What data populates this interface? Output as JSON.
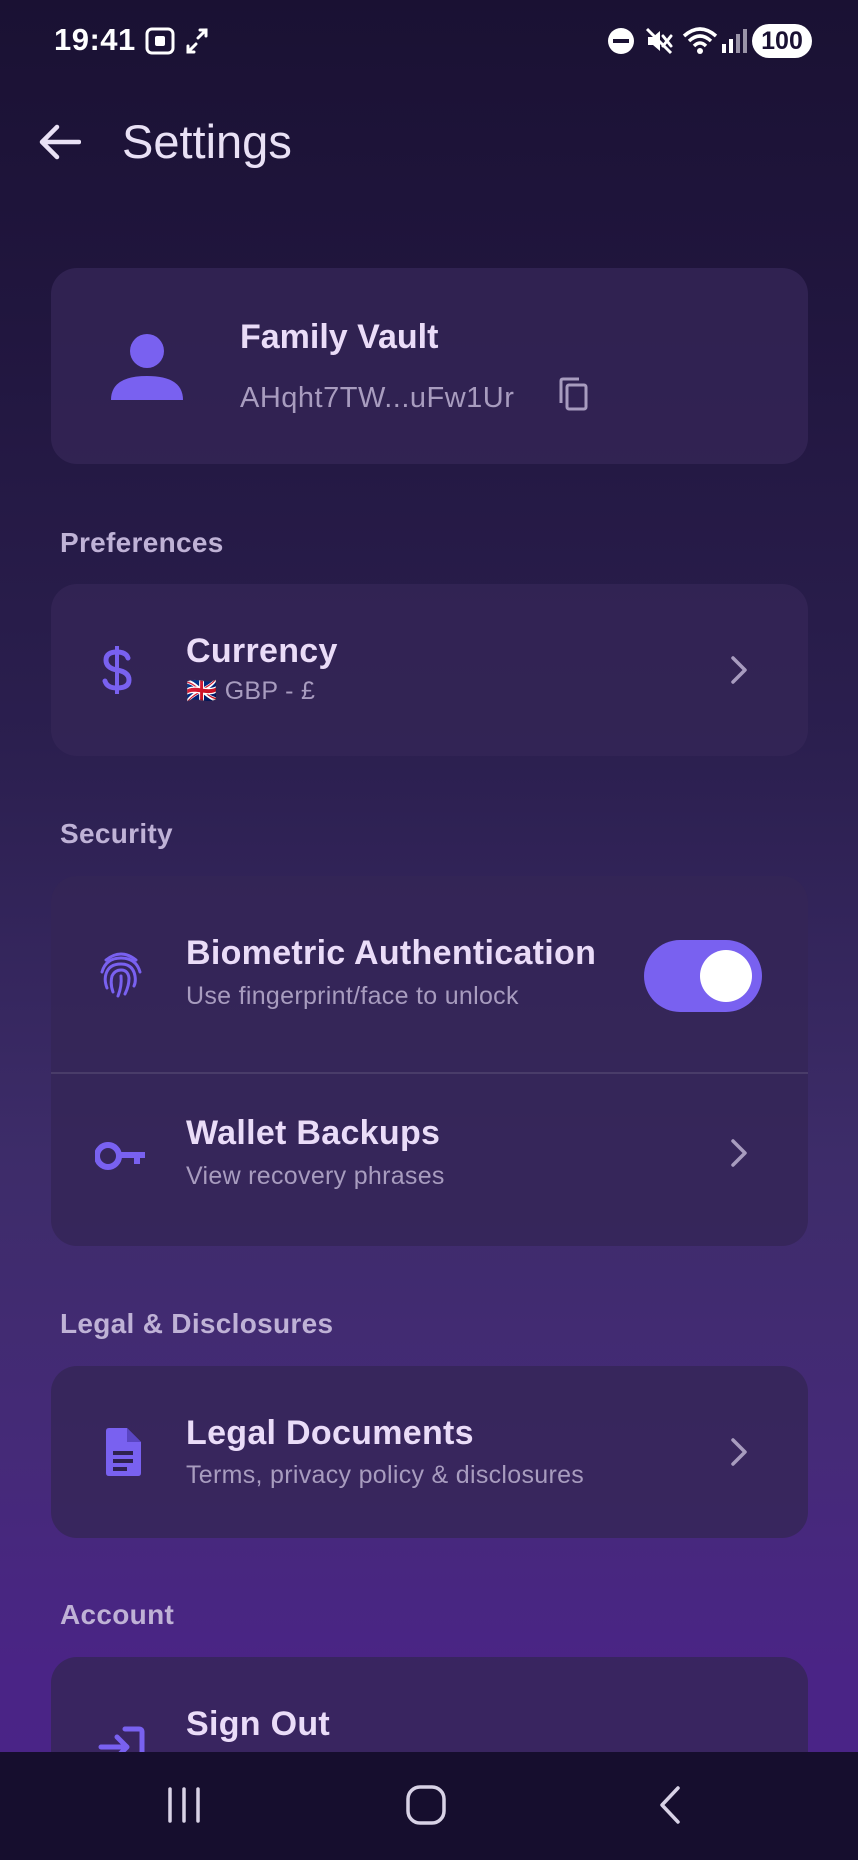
{
  "status_bar": {
    "time": "19:41",
    "battery": "100",
    "icons": [
      "screenshot-icon",
      "expand-icon",
      "do-not-disturb-icon",
      "mute-icon",
      "wifi-icon",
      "signal-icon",
      "battery-icon"
    ]
  },
  "header": {
    "title": "Settings",
    "back_icon": "arrow-left-icon"
  },
  "profile": {
    "name": "Family Vault",
    "address": "AHqht7TW...uFw1Ur",
    "avatar_icon": "person-icon",
    "copy_icon": "copy-icon"
  },
  "sections": {
    "preferences": "Preferences",
    "security": "Security",
    "legal": "Legal & Disclosures",
    "account": "Account"
  },
  "preferences": {
    "currency": {
      "title": "Currency",
      "flag": "🇬🇧",
      "value": "GBP - £",
      "icon": "dollar-icon"
    }
  },
  "security": {
    "biometric": {
      "title": "Biometric Authentication",
      "subtitle": "Use fingerprint/face to unlock",
      "enabled": true,
      "icon": "fingerprint-icon"
    },
    "backups": {
      "title": "Wallet Backups",
      "subtitle": "View recovery phrases",
      "icon": "key-icon"
    }
  },
  "legal": {
    "documents": {
      "title": "Legal Documents",
      "subtitle": "Terms, privacy policy & disclosures",
      "icon": "document-icon"
    }
  },
  "account": {
    "sign_out": {
      "title": "Sign Out",
      "icon": "sign-out-icon"
    }
  },
  "colors": {
    "accent": "#7961F0",
    "card": "#342556",
    "text_primary": "#EADCF8",
    "text_secondary": "#A89CBF",
    "nav_bar": "#160E2E"
  },
  "nav_bar": {
    "buttons": [
      "recent-apps-icon",
      "home-icon",
      "back-icon"
    ]
  }
}
